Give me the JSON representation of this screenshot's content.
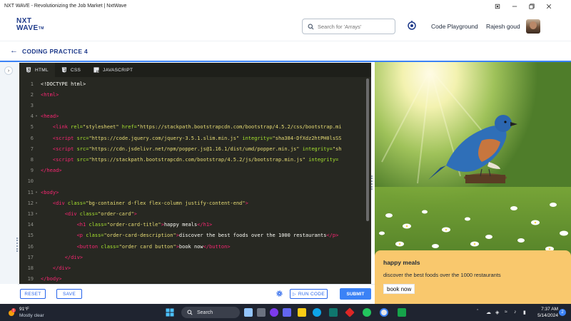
{
  "window": {
    "title": "NXT WAVE - Revolutionizing the Job Market | NxtWave"
  },
  "nav": {
    "logo_line1": "NXT",
    "logo_line2": "WAVE",
    "logo_tm": "TM",
    "search_placeholder": "Search for 'Arrays'",
    "code_playground": "Code Playground",
    "user_name": "Rajesh goud"
  },
  "practice": {
    "title": "CODING PRACTICE 4"
  },
  "editor": {
    "tabs": [
      {
        "label": "HTML",
        "icon": "html5-icon"
      },
      {
        "label": "CSS",
        "icon": "css3-icon"
      },
      {
        "label": "JAVASCRIPT",
        "icon": "javascript-icon"
      }
    ],
    "lines": [
      {
        "n": "1",
        "fold": "",
        "tokens": [
          {
            "c": "tx",
            "t": "<!DOCTYPE html>"
          }
        ]
      },
      {
        "n": "2",
        "fold": "",
        "tokens": [
          {
            "c": "tg",
            "t": "<html>"
          }
        ]
      },
      {
        "n": "3",
        "fold": "",
        "tokens": []
      },
      {
        "n": "4",
        "fold": "▾",
        "tokens": [
          {
            "c": "tg",
            "t": "<head>"
          }
        ]
      },
      {
        "n": "5",
        "fold": "",
        "tokens": [
          {
            "c": "tx",
            "t": "    "
          },
          {
            "c": "tg",
            "t": "<link"
          },
          {
            "c": "at",
            "t": " rel="
          },
          {
            "c": "st",
            "t": "\"stylesheet\""
          },
          {
            "c": "at",
            "t": " href="
          },
          {
            "c": "st",
            "t": "\"https://stackpath.bootstrapcdn.com/bootstrap/4.5.2/css/bootstrap.mi"
          }
        ]
      },
      {
        "n": "6",
        "fold": "",
        "tokens": [
          {
            "c": "tx",
            "t": "    "
          },
          {
            "c": "tg",
            "t": "<script"
          },
          {
            "c": "at",
            "t": " src="
          },
          {
            "c": "st",
            "t": "\"https://code.jquery.com/jquery-3.5.1.slim.min.js\""
          },
          {
            "c": "at",
            "t": " integrity="
          },
          {
            "c": "st",
            "t": "\"sha384-DfXdz2htPH0lsSS"
          }
        ]
      },
      {
        "n": "7",
        "fold": "",
        "tokens": [
          {
            "c": "tx",
            "t": "    "
          },
          {
            "c": "tg",
            "t": "<script"
          },
          {
            "c": "at",
            "t": " src="
          },
          {
            "c": "st",
            "t": "\"https://cdn.jsdelivr.net/npm/popper.js@1.16.1/dist/umd/popper.min.js\""
          },
          {
            "c": "at",
            "t": " integrity="
          },
          {
            "c": "st",
            "t": "\"sh"
          }
        ]
      },
      {
        "n": "8",
        "fold": "",
        "tokens": [
          {
            "c": "tx",
            "t": "    "
          },
          {
            "c": "tg",
            "t": "<script"
          },
          {
            "c": "at",
            "t": " src="
          },
          {
            "c": "st",
            "t": "\"https://stackpath.bootstrapcdn.com/bootstrap/4.5.2/js/bootstrap.min.js\""
          },
          {
            "c": "at",
            "t": " integrity="
          }
        ]
      },
      {
        "n": "9",
        "fold": "",
        "tokens": [
          {
            "c": "tg",
            "t": "</head>"
          }
        ]
      },
      {
        "n": "10",
        "fold": "",
        "tokens": []
      },
      {
        "n": "11",
        "fold": "▾",
        "tokens": [
          {
            "c": "tg",
            "t": "<body>"
          }
        ]
      },
      {
        "n": "12",
        "fold": "▾",
        "tokens": [
          {
            "c": "tx",
            "t": "    "
          },
          {
            "c": "tg",
            "t": "<div"
          },
          {
            "c": "at",
            "t": " class="
          },
          {
            "c": "st",
            "t": "\"bg-container d-flex flex-column justify-content-end\""
          },
          {
            "c": "tg",
            "t": ">"
          }
        ]
      },
      {
        "n": "13",
        "fold": "▾",
        "tokens": [
          {
            "c": "tx",
            "t": "        "
          },
          {
            "c": "tg",
            "t": "<div"
          },
          {
            "c": "at",
            "t": " class="
          },
          {
            "c": "st",
            "t": "\"order-card\""
          },
          {
            "c": "tg",
            "t": ">"
          }
        ]
      },
      {
        "n": "14",
        "fold": "",
        "tokens": [
          {
            "c": "tx",
            "t": "            "
          },
          {
            "c": "tg",
            "t": "<h1"
          },
          {
            "c": "at",
            "t": " class="
          },
          {
            "c": "st",
            "t": "\"order-card-title\""
          },
          {
            "c": "tg",
            "t": ">"
          },
          {
            "c": "tx",
            "t": "happy meals"
          },
          {
            "c": "tg",
            "t": "</h1>"
          }
        ]
      },
      {
        "n": "15",
        "fold": "",
        "tokens": [
          {
            "c": "tx",
            "t": "            "
          },
          {
            "c": "tg",
            "t": "<p"
          },
          {
            "c": "at",
            "t": " class="
          },
          {
            "c": "st",
            "t": "\"order-card-description\""
          },
          {
            "c": "tg",
            "t": ">"
          },
          {
            "c": "tx",
            "t": "discover the best foods over the 1000 restaurants"
          },
          {
            "c": "tg",
            "t": "</p>"
          }
        ]
      },
      {
        "n": "16",
        "fold": "",
        "tokens": [
          {
            "c": "tx",
            "t": "            "
          },
          {
            "c": "tg",
            "t": "<button"
          },
          {
            "c": "at",
            "t": " class="
          },
          {
            "c": "st",
            "t": "\"order card button\""
          },
          {
            "c": "tg",
            "t": ">"
          },
          {
            "c": "tx",
            "t": "book now"
          },
          {
            "c": "tg",
            "t": "</button>"
          }
        ]
      },
      {
        "n": "17",
        "fold": "",
        "tokens": [
          {
            "c": "tx",
            "t": "        "
          },
          {
            "c": "tg",
            "t": "</div>"
          }
        ]
      },
      {
        "n": "18",
        "fold": "",
        "tokens": [
          {
            "c": "tx",
            "t": "    "
          },
          {
            "c": "tg",
            "t": "</div>"
          }
        ]
      },
      {
        "n": "19",
        "fold": "",
        "tokens": [
          {
            "c": "tg",
            "t": "</body>"
          }
        ]
      }
    ]
  },
  "actions": {
    "reset": "RESET",
    "save": "SAVE",
    "run_code": "RUN CODE",
    "submit": "SUBMIT"
  },
  "preview": {
    "card_title": "happy meals",
    "card_description": "discover the best foods over the 1000 restaurants",
    "card_button": "book now"
  },
  "taskbar": {
    "temperature": "91°F",
    "weather": "Mostly clear",
    "search": "Search",
    "time": "7:37 AM",
    "date": "5/14/2024",
    "notifications": "2",
    "weather_badge": "1"
  },
  "colors": {
    "accent": "#3b82f6",
    "brand": "#1e3a8a",
    "editor_bg": "#272822",
    "card_bg": "#f9c86d"
  }
}
